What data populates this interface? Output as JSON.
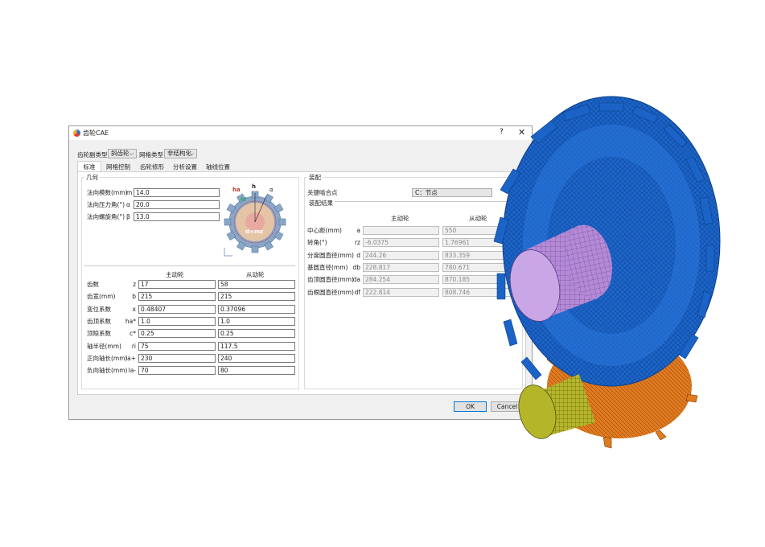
{
  "window": {
    "title": "齿轮CAE",
    "help": "?",
    "close": "✕"
  },
  "toolbar": {
    "pair_type_label": "齿轮副类型",
    "pair_type_value": "斜齿轮",
    "mesh_type_label": "网格类型",
    "mesh_type_value": "非结构化"
  },
  "tabs": [
    "标准",
    "网格控制",
    "齿轮修形",
    "分析设置",
    "轴线位置"
  ],
  "geometry": {
    "title": "几何",
    "params": [
      {
        "label": "法向模数(mm)",
        "sym": "m",
        "value": "14.0"
      },
      {
        "label": "法向压力角(°)",
        "sym": "α",
        "value": "20.0"
      },
      {
        "label": "法向螺旋角(°)",
        "sym": "β",
        "value": "13.0"
      }
    ],
    "diagram_labels": {
      "ha": "ha",
      "h": "h",
      "hf": "hf",
      "alpha": "α",
      "d": "d=mz"
    },
    "table_headers": {
      "driver": "主动轮",
      "driven": "从动轮"
    },
    "rows": [
      {
        "label": "齿数",
        "sym": "z",
        "driver": "17",
        "driven": "58"
      },
      {
        "label": "齿宽(mm)",
        "sym": "b",
        "driver": "215",
        "driven": "215"
      },
      {
        "label": "变位系数",
        "sym": "x",
        "driver": "0.48407",
        "driven": "0.37096"
      },
      {
        "label": "齿顶系数",
        "sym": "ha*",
        "driver": "1.0",
        "driven": "1.0"
      },
      {
        "label": "顶隙系数",
        "sym": "c*",
        "driver": "0.25",
        "driven": "0.25"
      },
      {
        "label": "轴半径(mm)",
        "sym": "ri",
        "driver": "75",
        "driven": "117.5"
      },
      {
        "label": "正向轴长(mm)",
        "sym": "la+",
        "driver": "230",
        "driven": "240"
      },
      {
        "label": "负向轴长(mm)",
        "sym": "la-",
        "driver": "70",
        "driven": "80"
      }
    ]
  },
  "assembly": {
    "title": "装配",
    "key_point_label": "关键啮合点",
    "key_point_value": "C：节点",
    "results_title": "装配结果",
    "headers": {
      "driver": "主动轮",
      "driven": "从动轮"
    },
    "rows": [
      {
        "label": "中心距(mm)",
        "sym": "a",
        "driver": "",
        "driven": "550"
      },
      {
        "label": "转角(°)",
        "sym": "rz",
        "driver": "-6.0375",
        "driven": "1.76961"
      },
      {
        "label": "分度圆直径(mm)",
        "sym": "d",
        "driver": "244.26",
        "driven": "833.359"
      },
      {
        "label": "基圆直径(mm)",
        "sym": "db",
        "driver": "228.817",
        "driven": "780.671"
      },
      {
        "label": "齿顶圆直径(mm)",
        "sym": "da",
        "driver": "284.254",
        "driven": "870.185"
      },
      {
        "label": "齿根圆直径(mm)",
        "sym": "df",
        "driver": "222.814",
        "driven": "808.746"
      }
    ]
  },
  "buttons": {
    "ok": "OK",
    "cancel": "Cancel"
  },
  "colors": {
    "big_gear": "#1b63c7",
    "shaft_big": "#b48ad8",
    "small_gear": "#e07a1f",
    "shaft_small": "#b5b52a"
  }
}
